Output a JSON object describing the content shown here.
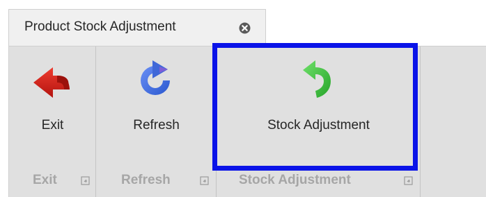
{
  "tab": {
    "title": "Product Stock Adjustment",
    "close_icon": "close-circle-icon"
  },
  "ribbon": {
    "groups": [
      {
        "id": "exit",
        "label": "Exit",
        "button": {
          "label": "Exit",
          "icon": "exit-arrow-icon",
          "color": "#d0241b"
        }
      },
      {
        "id": "refresh",
        "label": "Refresh",
        "button": {
          "label": "Refresh",
          "icon": "refresh-icon",
          "color": "#3f6ee0"
        }
      },
      {
        "id": "stock",
        "label": "Stock Adjustment",
        "button": {
          "label": "Stock Adjustment",
          "icon": "undo-arrow-icon",
          "color": "#3fbf3f"
        }
      }
    ]
  },
  "highlight_color": "#0a13e8"
}
